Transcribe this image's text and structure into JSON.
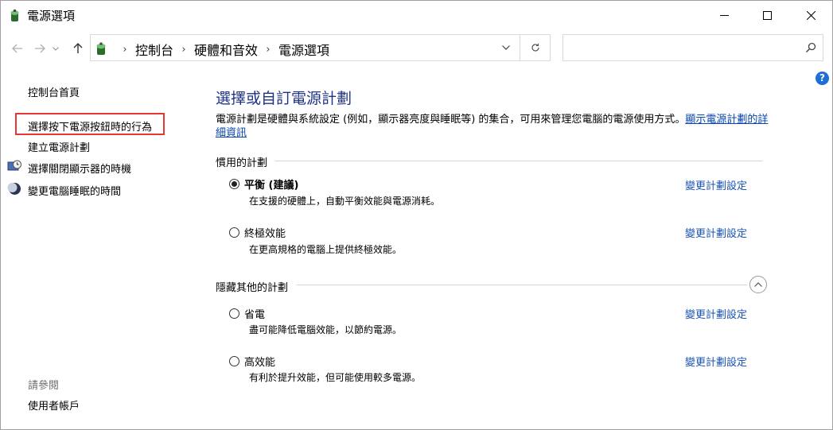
{
  "window": {
    "title": "電源選項",
    "icon": "battery-power-icon",
    "controls": {
      "minimize": "minimize-icon",
      "maximize": "maximize-icon",
      "close": "close-icon"
    }
  },
  "address": {
    "breadcrumbs": [
      "控制台",
      "硬體和音效",
      "電源選項"
    ],
    "search_placeholder": ""
  },
  "help": {
    "label": "?"
  },
  "sidebar": {
    "home": "控制台首頁",
    "links": [
      {
        "label": "選擇按下電源按鈕時的行為",
        "highlighted": true
      },
      {
        "label": "建立電源計劃"
      },
      {
        "label": "選擇關閉顯示器的時機",
        "icon": "monitor-clock-icon"
      },
      {
        "label": "變更電腦睡眠的時間",
        "icon": "moon-icon"
      }
    ],
    "see_also": "請參閱",
    "see_also_links": [
      "使用者帳戶"
    ]
  },
  "main": {
    "title": "選擇或自訂電源計劃",
    "description": "電源計劃是硬體與系統設定 (例如，顯示器亮度與睡眠等) 的集合，可用來管理您電腦的電源使用方式。",
    "description_link": "顯示電源計劃的詳細資訊",
    "preferred_label": "慣用的計劃",
    "hidden_label": "隱藏其他的計劃",
    "change_link": "變更計劃設定",
    "plans": [
      {
        "name": "平衡 (建議)",
        "desc": "在支援的硬體上，自動平衡效能與電源消耗。",
        "selected": true
      },
      {
        "name": "終極效能",
        "desc": "在更高規格的電腦上提供終極效能。",
        "selected": false
      }
    ],
    "hidden_plans": [
      {
        "name": "省電",
        "desc": "盡可能降低電腦效能，以節約電源。",
        "selected": false
      },
      {
        "name": "高效能",
        "desc": "有利於提升效能，但可能使用較多電源。",
        "selected": false
      }
    ]
  },
  "colors": {
    "title_blue": "#1e3287",
    "link_blue": "#1a55b3",
    "highlight_red": "#e53935"
  }
}
